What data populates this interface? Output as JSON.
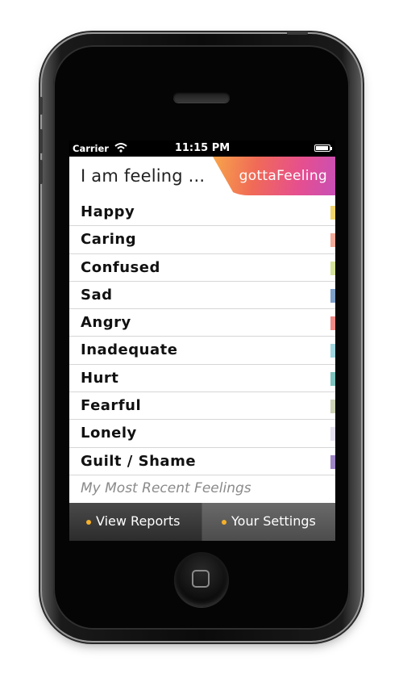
{
  "status_bar": {
    "carrier": "Carrier",
    "time": "11:15 PM"
  },
  "header": {
    "title": "I am feeling ...",
    "logo": "gottaFeeling"
  },
  "feelings": [
    {
      "label": "Happy",
      "color": "#f2d56a"
    },
    {
      "label": "Caring",
      "color": "#f3aa98"
    },
    {
      "label": "Confused",
      "color": "#d5e39a"
    },
    {
      "label": "Sad",
      "color": "#7fa0c9"
    },
    {
      "label": "Angry",
      "color": "#ef8a86"
    },
    {
      "label": "Inadequate",
      "color": "#9fd6df"
    },
    {
      "label": "Hurt",
      "color": "#7ec3bd"
    },
    {
      "label": "Fearful",
      "color": "#cdd3b6"
    },
    {
      "label": "Lonely",
      "color": "#e6e1ee"
    },
    {
      "label": "Guilt / Shame",
      "color": "#9f86c6"
    }
  ],
  "recent": {
    "label": "My Most Recent Feelings"
  },
  "tabbar": {
    "left": "View Reports",
    "right": "Your Settings",
    "dot_color": "#f5b12b"
  }
}
